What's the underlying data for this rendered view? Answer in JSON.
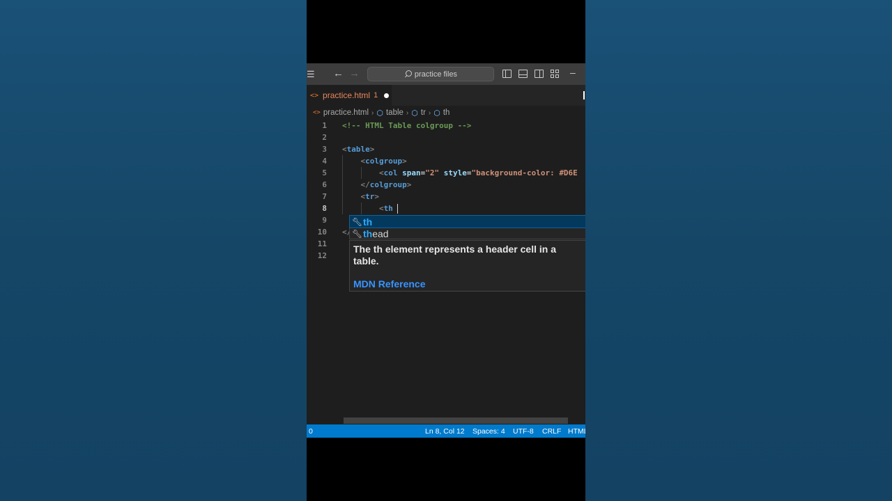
{
  "titlebar": {
    "menu_icon": "menu-icon",
    "back_icon": "arrow-left-icon",
    "forward_icon": "arrow-right-icon",
    "search_text": "practice files"
  },
  "tab": {
    "icon_glyph": "<>",
    "label": "practice.html",
    "problem_count": "1"
  },
  "breadcrumb": {
    "file": "practice.html",
    "items": [
      "table",
      "tr",
      "th"
    ]
  },
  "editor": {
    "lines": [
      {
        "n": "1",
        "parts": [
          {
            "t": "<!-- HTML Table colgroup -->",
            "c": "c-comment"
          }
        ]
      },
      {
        "n": "2",
        "parts": []
      },
      {
        "n": "3",
        "parts": [
          {
            "t": "<",
            "c": "c-bracket"
          },
          {
            "t": "table",
            "c": "c-tag"
          },
          {
            "t": ">",
            "c": "c-bracket"
          }
        ]
      },
      {
        "n": "4",
        "parts": [
          {
            "t": "    ",
            "c": "c-text"
          },
          {
            "t": "<",
            "c": "c-bracket"
          },
          {
            "t": "colgroup",
            "c": "c-tag"
          },
          {
            "t": ">",
            "c": "c-bracket"
          }
        ]
      },
      {
        "n": "5",
        "parts": [
          {
            "t": "        ",
            "c": "c-text"
          },
          {
            "t": "<",
            "c": "c-bracket"
          },
          {
            "t": "col",
            "c": "c-tag"
          },
          {
            "t": " span",
            "c": "c-attr"
          },
          {
            "t": "=",
            "c": "c-text"
          },
          {
            "t": "\"2\"",
            "c": "c-str"
          },
          {
            "t": " style",
            "c": "c-attr"
          },
          {
            "t": "=",
            "c": "c-text"
          },
          {
            "t": "\"background-color: #D6E",
            "c": "c-str"
          }
        ]
      },
      {
        "n": "6",
        "parts": [
          {
            "t": "    ",
            "c": "c-text"
          },
          {
            "t": "</",
            "c": "c-bracket"
          },
          {
            "t": "colgroup",
            "c": "c-tag"
          },
          {
            "t": ">",
            "c": "c-bracket"
          }
        ]
      },
      {
        "n": "7",
        "parts": [
          {
            "t": "    ",
            "c": "c-text"
          },
          {
            "t": "<",
            "c": "c-bracket"
          },
          {
            "t": "tr",
            "c": "c-tag"
          },
          {
            "t": ">",
            "c": "c-bracket"
          }
        ]
      },
      {
        "n": "8",
        "parts": [
          {
            "t": "        ",
            "c": "c-text"
          },
          {
            "t": "<",
            "c": "c-bracket"
          },
          {
            "t": "th",
            "c": "c-tag"
          }
        ]
      },
      {
        "n": "9",
        "parts": []
      },
      {
        "n": "10",
        "parts": [
          {
            "t": "</",
            "c": "c-bracket"
          }
        ]
      },
      {
        "n": "11",
        "parts": []
      },
      {
        "n": "12",
        "parts": []
      }
    ],
    "active_line": "8"
  },
  "suggest": {
    "items": [
      {
        "match": "th",
        "rest": "",
        "icon": "wrench-icon"
      },
      {
        "match": "th",
        "rest": "ead",
        "icon": "wrench-icon"
      }
    ],
    "detail": "The th element represents a header cell in a table.",
    "link": "MDN Reference"
  },
  "statusbar": {
    "left": "0",
    "position": "Ln 8, Col 12",
    "spaces": "Spaces: 4",
    "encoding": "UTF-8",
    "eol": "CRLF",
    "language": "HTML"
  },
  "colors": {
    "background": "#164a6e",
    "statusbar": "#007acc",
    "editor": "#1e1e1e",
    "selection": "#04395e"
  }
}
